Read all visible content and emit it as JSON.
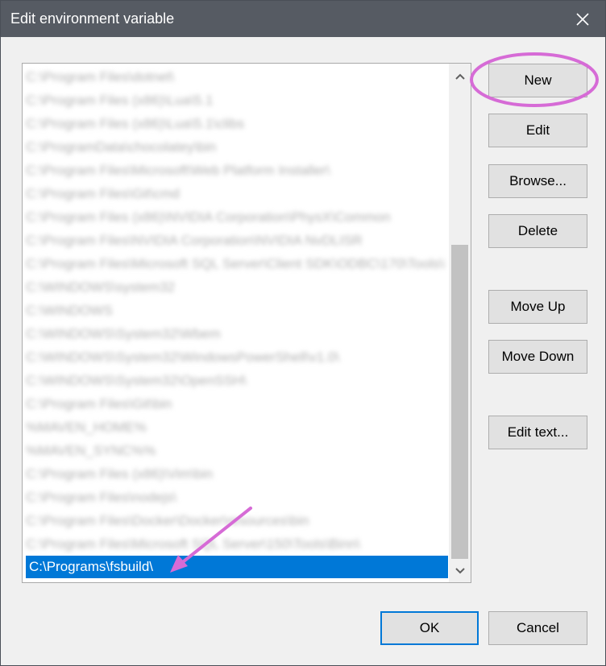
{
  "window": {
    "title": "Edit environment variable"
  },
  "list": {
    "items": [
      "C:\\Program Files\\dotnet\\",
      "C:\\Program Files (x86)\\Lua\\5.1",
      "C:\\Program Files (x86)\\Lua\\5.1\\clibs",
      "C:\\ProgramData\\chocolatey\\bin",
      "C:\\Program Files\\Microsoft\\Web Platform Installer\\",
      "C:\\Program Files\\Git\\cmd",
      "C:\\Program Files (x86)\\NVIDIA Corporation\\PhysX\\Common",
      "C:\\Program Files\\NVIDIA Corporation\\NVIDIA NvDLISR",
      "C:\\Program Files\\Microsoft SQL Server\\Client SDK\\ODBC\\170\\Tools\\Binn\\",
      "C:\\WINDOWS\\system32",
      "C:\\WINDOWS",
      "C:\\WINDOWS\\System32\\Wbem",
      "C:\\WINDOWS\\System32\\WindowsPowerShell\\v1.0\\",
      "C:\\WINDOWS\\System32\\OpenSSH\\",
      "C:\\Program Files\\Git\\bin",
      "%MAVEN_HOME%",
      "%MAVEN_SYNC%%",
      "C:\\Program Files (x86)\\Vim\\bin",
      "C:\\Program Files\\nodejs\\",
      "C:\\Program Files\\Docker\\Docker\\resources\\bin",
      "C:\\Program Files\\Microsoft SQL Server\\150\\Tools\\Binn\\"
    ],
    "selected": "C:\\Programs\\fsbuild\\"
  },
  "buttons": {
    "new": "New",
    "edit": "Edit",
    "browse": "Browse...",
    "delete": "Delete",
    "move_up": "Move Up",
    "move_down": "Move Down",
    "edit_text": "Edit text...",
    "ok": "OK",
    "cancel": "Cancel"
  },
  "colors": {
    "titlebar": "#565b63",
    "selection": "#0078d7",
    "annotation": "#d66bd6"
  }
}
